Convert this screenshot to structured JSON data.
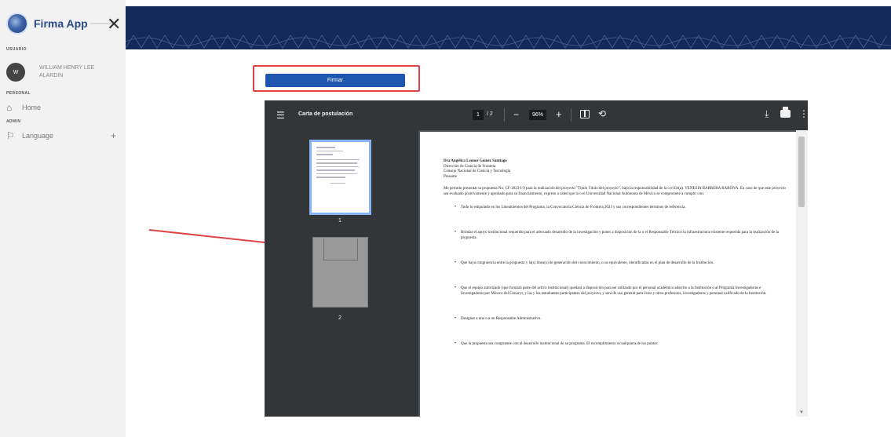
{
  "sidebar": {
    "brand_name": "Firma App",
    "close_icon_text": "✕",
    "section_user": "USUARIO",
    "user_initials": "W",
    "user_name": "WILLIAM HENRY LEE ALARDIN",
    "section_personal": "PERSONAL",
    "home_label": "Home",
    "section_admin": "ADMIN",
    "language_label": "Language",
    "language_expand": "+"
  },
  "sign_button": {
    "label": "Firmar"
  },
  "pdf_viewer": {
    "title": "Carta de postulación",
    "page_current": "1",
    "page_total": "/ 2",
    "zoom": "96%",
    "thumbnails": [
      {
        "label": "1"
      },
      {
        "label": "2"
      }
    ]
  },
  "document": {
    "addressee_name": "Dra Angélica Leonor Gómez Santiago",
    "addressee_line2": "Dirección de Ciencia de Frontera",
    "addressee_line3": "Consejo Nacional de Ciencia y Tecnología",
    "addressee_line4": "Presente",
    "intro": "Me permito presentar la propuesta No. CF-2023-I-9 para la realización del proyecto \"Título Título del proyecto\", bajo la responsabilidad de la o el Dr(a). VENESIA BARRERA BARONA. En caso de que este proyecto sea evaluado positivamente y aprobado para su financiamiento, expreso a usted que la o el Universidad Nacional Autónoma de México se compromete a cumplir con:",
    "bullets": [
      "Todo lo estipulado en los Lineamientos del Programa, la Convocatoria Ciencia de Frontera 2023 y sus correspondientes términos de referencia.",
      "Brindar el apoyo institucional requerido para el adecuado desarrollo de la investigación y poner a disposición de la o el Responsable Técnico la infraestructura existente requerida para la realización de la propuesta.",
      "Que haya congruencia entre la propuesta y la(s) línea(s) de generación del conocimiento, o su equivalente, identificadas en el plan de desarrollo de la Institución.",
      "Que el equipo autorizado (que formará parte del activo institucional) quedará a disposición para ser utilizado por el personal académico adscrito a la Institución o al Programa Investigadoras e Investigadores por México del Conacyt, y las y los estudiantes participantes del proyecto, y será de uso general para éstos y otros profesores, investigadores y personal calificado de la Institución.",
      "Designar a una o a un Responsable Administrativo.",
      "Que la propuesta sea congruente con el desarrollo institucional de su programa. El incumplimiento a cualquiera de los puntos"
    ]
  }
}
